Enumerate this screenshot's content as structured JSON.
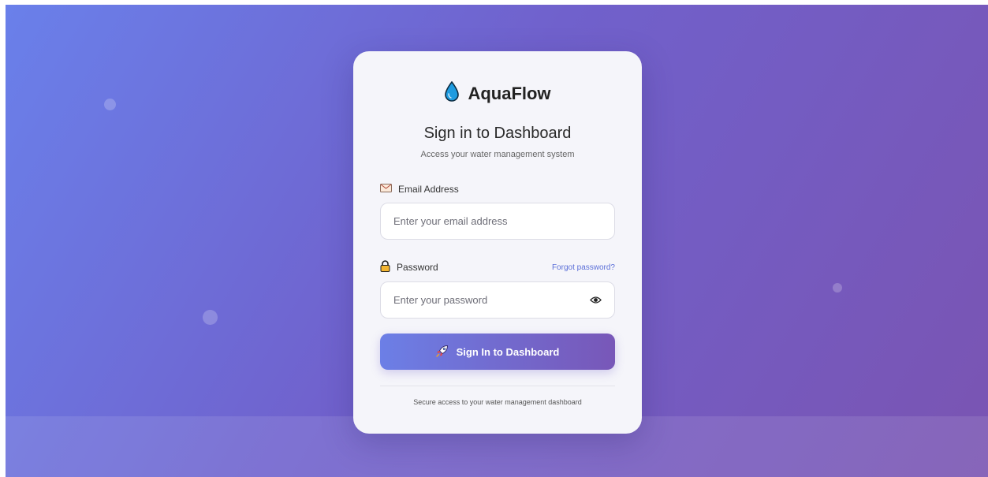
{
  "brand": {
    "name": "AquaFlow",
    "icon": "water-drop-icon"
  },
  "login": {
    "title": "Sign in to Dashboard",
    "subtitle": "Access your water management system",
    "email": {
      "label": "Email Address",
      "icon": "envelope-icon",
      "placeholder": "Enter your email address",
      "value": ""
    },
    "password": {
      "label": "Password",
      "icon": "lock-icon",
      "placeholder": "Enter your password",
      "value": "",
      "forgot_label": "Forgot password?",
      "toggle_icon": "eye-icon"
    },
    "submit": {
      "label": "Sign In to Dashboard",
      "icon": "rocket-icon"
    },
    "footer_note": "Secure access to your water management dashboard"
  },
  "colors": {
    "background_start": "#6a80ea",
    "background_end": "#7a54b2",
    "card": "#f5f5fa",
    "drop": "#1e9be0",
    "link": "#5b6fd8",
    "button_start": "#6c7fe6",
    "button_end": "#7857b8"
  }
}
